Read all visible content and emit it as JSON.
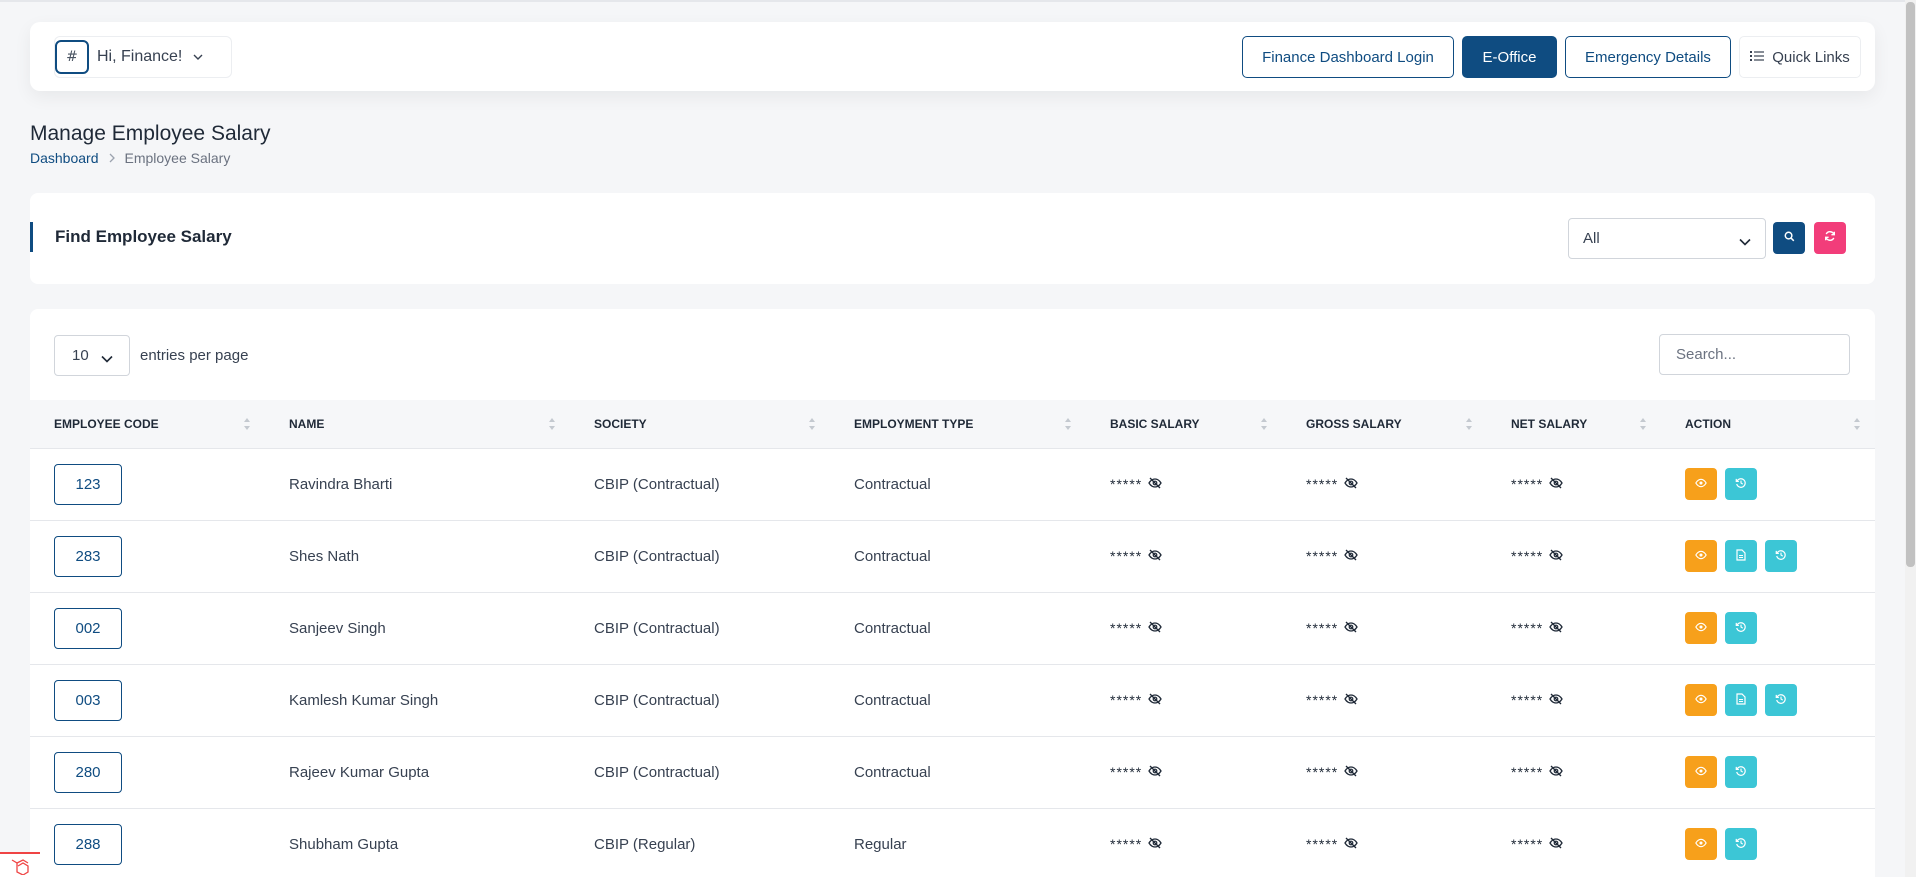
{
  "header": {
    "greeting": "Hi, Finance!",
    "avatar_alt": "#",
    "buttons": {
      "finance_dashboard": "Finance Dashboard Login",
      "eoffice": "E-Office",
      "emergency": "Emergency Details",
      "quick_links": "Quick Links"
    }
  },
  "page": {
    "title": "Manage Employee Salary",
    "breadcrumb": {
      "home": "Dashboard",
      "current": "Employee Salary"
    }
  },
  "filter": {
    "title": "Find Employee Salary",
    "select_value": "All"
  },
  "table": {
    "per_page_value": "10",
    "per_page_label": "entries per page",
    "search_placeholder": "Search...",
    "columns": [
      "Employee Code",
      "Name",
      "Society",
      "Employment Type",
      "Basic Salary",
      "Gross Salary",
      "Net Salary",
      "Action"
    ],
    "mask": "*****",
    "rows": [
      {
        "code": "123",
        "name": "Ravindra Bharti",
        "society": "CBIP (Contractual)",
        "type": "Contractual",
        "actions": [
          "view",
          "history"
        ]
      },
      {
        "code": "283",
        "name": "Shes Nath",
        "society": "CBIP (Contractual)",
        "type": "Contractual",
        "actions": [
          "view",
          "document",
          "history"
        ]
      },
      {
        "code": "002",
        "name": "Sanjeev Singh",
        "society": "CBIP (Contractual)",
        "type": "Contractual",
        "actions": [
          "view",
          "history"
        ]
      },
      {
        "code": "003",
        "name": "Kamlesh Kumar Singh",
        "society": "CBIP (Contractual)",
        "type": "Contractual",
        "actions": [
          "view",
          "document",
          "history"
        ]
      },
      {
        "code": "280",
        "name": "Rajeev Kumar Gupta",
        "society": "CBIP (Contractual)",
        "type": "Contractual",
        "actions": [
          "view",
          "history"
        ]
      },
      {
        "code": "288",
        "name": "Shubham Gupta",
        "society": "CBIP (Regular)",
        "type": "Regular",
        "actions": [
          "view",
          "history"
        ]
      }
    ]
  },
  "colors": {
    "primary": "#0f4c81",
    "view_action": "#f7a01b",
    "info_action": "#3cc6d6",
    "reset": "#f23d7a"
  }
}
